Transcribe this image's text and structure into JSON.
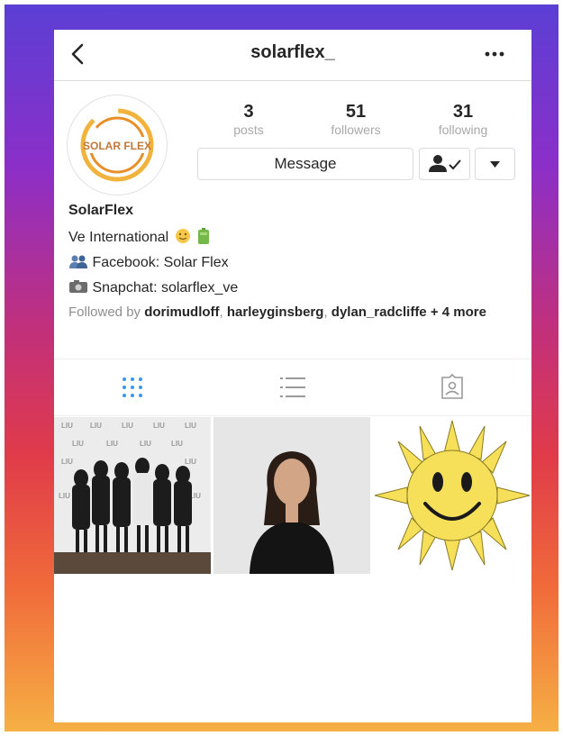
{
  "header": {
    "username": "solarflex_"
  },
  "profile": {
    "avatar_text": "SOLAR FLEX",
    "stats": [
      {
        "value": "3",
        "label": "posts"
      },
      {
        "value": "51",
        "label": "followers"
      },
      {
        "value": "31",
        "label": "following"
      }
    ],
    "message_label": "Message"
  },
  "bio": {
    "name": "SolarFlex",
    "line1": "Ve International",
    "line2": "Facebook: Solar Flex",
    "line3": "Snapchat: solarflex_ve",
    "followed_prefix": "Followed by ",
    "followed_users": [
      "dorimudloff",
      "harleyginsberg",
      "dylan_radcliffe"
    ],
    "followed_suffix": " + 4 more"
  },
  "colors": {
    "accent_blue": "#3897f0",
    "sun_yellow": "#f6e05a"
  },
  "icons": [
    "back-arrow-icon",
    "more-options-icon",
    "person-check-icon",
    "dropdown-arrow-icon",
    "grid-view-icon",
    "list-view-icon",
    "tagged-icon"
  ]
}
